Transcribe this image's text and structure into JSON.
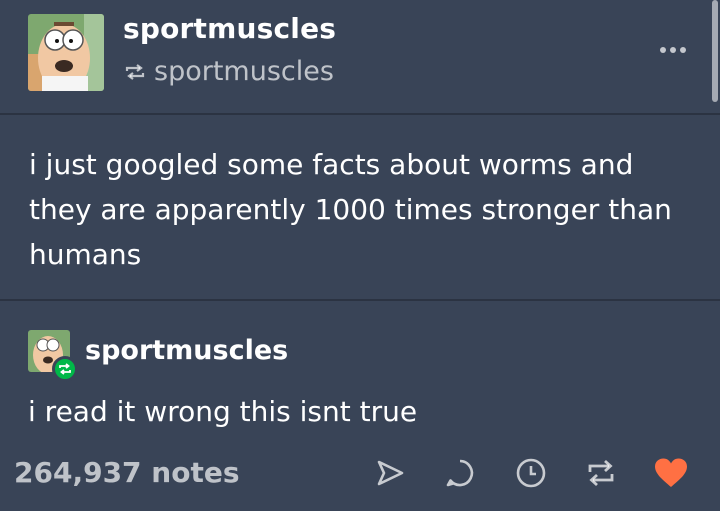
{
  "post": {
    "blog_name": "sportmuscles",
    "reblogged_from": "sportmuscles",
    "text_lines": [
      "i just googled some facts about worms and",
      "they are apparently 1000 times stronger than",
      "humans"
    ]
  },
  "reblog": {
    "blog_name": "sportmuscles",
    "text": "i read it wrong this isnt true"
  },
  "footer": {
    "notes": "264,937 notes",
    "icons": [
      "share-icon",
      "reply-icon",
      "clock-icon",
      "reblog-icon",
      "heart-icon"
    ]
  },
  "colors": {
    "background": "#394457",
    "text": "#ffffff",
    "muted": "#a9afba",
    "heart": "#ff7043",
    "reblog_badge": "#00b848"
  }
}
